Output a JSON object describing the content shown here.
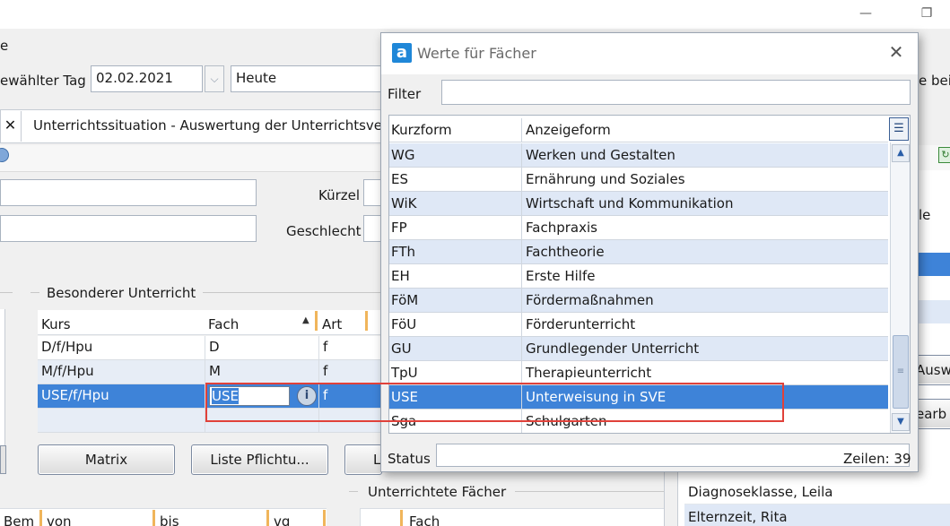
{
  "main": {
    "menu_partial": "e",
    "selected_day_label": "ewählter Tag",
    "selected_day_value": "02.02.2021",
    "relative_day_value": "Heute",
    "right_cut_label": "e bei",
    "tab_title": "Unterrichtssituation - Auswertung der Unterrichtsve",
    "kuerzel_label": "Kürzel",
    "geschlecht_label": "Geschlecht",
    "group_special": "Besonderer Unterricht",
    "grid_headers": {
      "kurs": "Kurs",
      "fach": "Fach",
      "art": "Art"
    },
    "grid_rows": [
      {
        "kurs": "D/f/Hpu",
        "fach": "D",
        "art": "f"
      },
      {
        "kurs": "M/f/Hpu",
        "fach": "M",
        "art": "f"
      },
      {
        "kurs": "USE/f/Hpu",
        "fach": "USE",
        "art": "f"
      }
    ],
    "btn_matrix": "Matrix",
    "btn_liste": "Liste Pflichtu...",
    "btn_partial": "L",
    "group_taught": "Unterrichtete Fächer",
    "bottom_headers": {
      "bem": "Bem",
      "von": "von",
      "bis": "bis",
      "vg": "vg",
      "fach": "Fach"
    },
    "right_labels": {
      "le": "le",
      "auswahl": "Auswä",
      "bearb": "earb"
    },
    "right_list": [
      "Diagnoseklasse, Leila",
      "Elternzeit, Rita"
    ]
  },
  "dialog": {
    "logo": "a",
    "title": "Werte für Fächer",
    "filter_label": "Filter",
    "filter_value": "",
    "col_kurz": "Kurzform",
    "col_anzeige": "Anzeigeform",
    "rows": [
      {
        "k": "WG",
        "a": "Werken und Gestalten"
      },
      {
        "k": "ES",
        "a": "Ernährung und Soziales"
      },
      {
        "k": "WiK",
        "a": "Wirtschaft und Kommunikation"
      },
      {
        "k": "FP",
        "a": "Fachpraxis"
      },
      {
        "k": "FTh",
        "a": "Fachtheorie"
      },
      {
        "k": "EH",
        "a": "Erste Hilfe"
      },
      {
        "k": "FöM",
        "a": "Fördermaßnahmen"
      },
      {
        "k": "FöU",
        "a": "Förderunterricht"
      },
      {
        "k": "GU",
        "a": "Grundlegender Unterricht"
      },
      {
        "k": "TpU",
        "a": "Therapieunterricht"
      },
      {
        "k": "USE",
        "a": "Unterweisung in SVE"
      },
      {
        "k": "Sga",
        "a": "Schulgarten"
      }
    ],
    "status_label": "Status",
    "status_value": "",
    "rows_count": "Zeilen: 39"
  }
}
